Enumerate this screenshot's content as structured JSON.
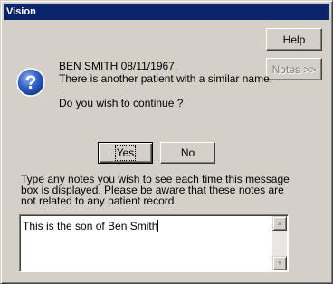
{
  "window": {
    "title": "Vision"
  },
  "buttons": {
    "help": "Help",
    "notes": "Notes >>",
    "yes": "Yes",
    "no": "No"
  },
  "message": {
    "line1": "BEN SMITH 08/11/1967.",
    "line2": "There is another patient with a similar name.",
    "question": "Do you wish to continue ?"
  },
  "notes": {
    "label": "Type any notes you wish to see each time this message box is displayed.  Please be aware that these notes are not related to any patient record.",
    "value": "This is the son of Ben Smith"
  },
  "icons": {
    "message_icon": "question-icon",
    "scroll_up": "arrow-up-icon",
    "scroll_down": "arrow-down-icon"
  },
  "colors": {
    "titlebar": "#0a246a",
    "face": "#d4d0c8",
    "question_icon": "#2c5cc5"
  }
}
